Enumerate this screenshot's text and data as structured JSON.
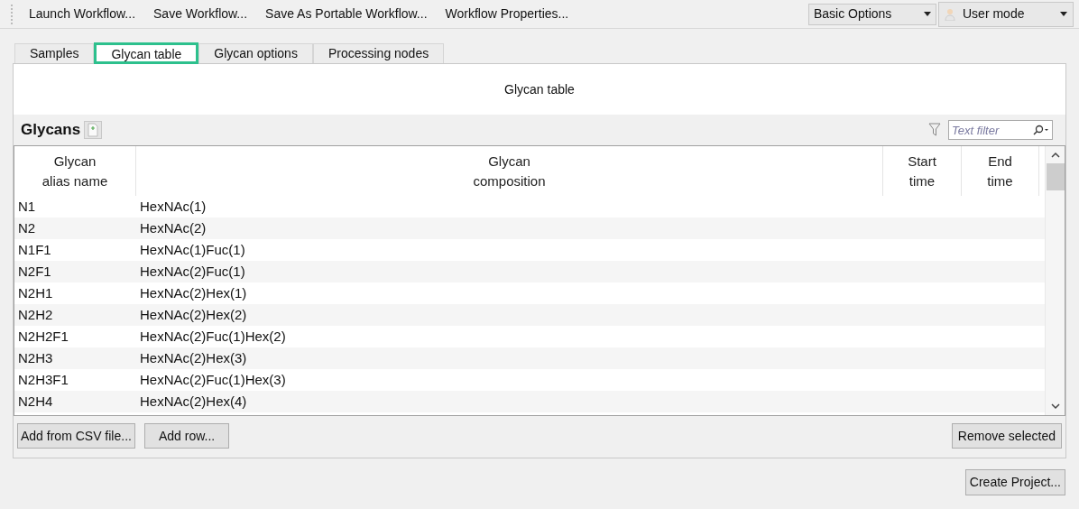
{
  "toolbar": {
    "actions": [
      "Launch Workflow...",
      "Save Workflow...",
      "Save As Portable Workflow...",
      "Workflow Properties..."
    ],
    "options_dropdown": {
      "value": "Basic Options"
    },
    "mode_dropdown": {
      "value": "User mode"
    }
  },
  "tabs": [
    {
      "label": "Samples",
      "selected": false
    },
    {
      "label": "Glycan table",
      "selected": true
    },
    {
      "label": "Glycan options",
      "selected": false
    },
    {
      "label": "Processing nodes",
      "selected": false
    }
  ],
  "panel": {
    "title": "Glycan table",
    "section_title": "Glycans",
    "filter": {
      "placeholder": "Text filter"
    },
    "table": {
      "columns": [
        "Glycan\nalias name",
        "Glycan\ncomposition",
        "Start\ntime",
        "End\ntime"
      ],
      "rows": [
        [
          "N1",
          "HexNAc(1)"
        ],
        [
          "N2",
          "HexNAc(2)"
        ],
        [
          "N1F1",
          "HexNAc(1)Fuc(1)"
        ],
        [
          "N2F1",
          "HexNAc(2)Fuc(1)"
        ],
        [
          "N2H1",
          "HexNAc(2)Hex(1)"
        ],
        [
          "N2H2",
          "HexNAc(2)Hex(2)"
        ],
        [
          "N2H2F1",
          "HexNAc(2)Fuc(1)Hex(2)"
        ],
        [
          "N2H3",
          "HexNAc(2)Hex(3)"
        ],
        [
          "N2H3F1",
          "HexNAc(2)Fuc(1)Hex(3)"
        ],
        [
          "N2H4",
          "HexNAc(2)Hex(4)"
        ]
      ]
    },
    "left_buttons": [
      "Add from CSV file...",
      "Add row..."
    ],
    "right_button": "Remove selected"
  },
  "footer_button": "Create Project..."
}
